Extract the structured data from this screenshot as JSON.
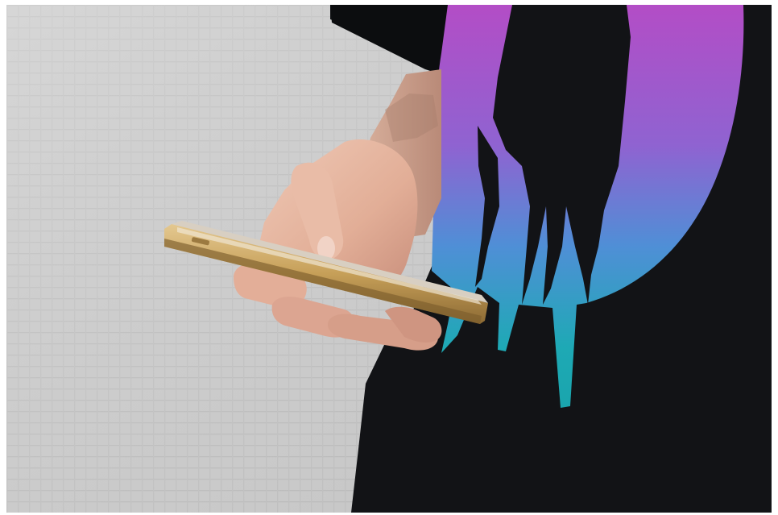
{
  "scene": {
    "colors": {
      "pavement": "#c6c6c6",
      "pavement_light": "#d6d6d6",
      "shirt": "#111214",
      "print_teal": "#1fa8b3",
      "print_purple": "#b04fc4",
      "print_blue": "#5a7fd6",
      "skin": "#e7b8a3",
      "skin_shadow": "#c78f7d",
      "phone_gold": "#c7a15a",
      "phone_edge": "#8a6b35",
      "phone_glass": "#d9cfc0"
    }
  }
}
